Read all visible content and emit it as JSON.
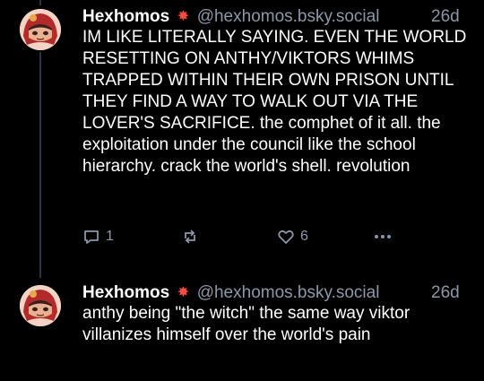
{
  "posts": [
    {
      "author": {
        "display_name": "Hexhomos",
        "badge_icon": "sparkle-emoji",
        "handle": "@hexhomos.bsky.social",
        "time": "26d"
      },
      "text": "IM LIKE LITERALLY SAYING. EVEN THE WORLD RESETTING ON ANTHY/VIKTORS WHIMS TRAPPED WITHIN THEIR OWN PRISON UNTIL THEY FIND A WAY TO WALK OUT VIA THE LOVER'S SACRIFICE. the comphet of it all. the exploitation under the council like the school hierarchy. crack the world's shell. revolution",
      "actions": {
        "reply_count": "1",
        "repost_count": "",
        "like_count": "6"
      }
    },
    {
      "author": {
        "display_name": "Hexhomos",
        "badge_icon": "sparkle-emoji",
        "handle": "@hexhomos.bsky.social",
        "time": "26d"
      },
      "text": "anthy being \"the witch\" the same way viktor villanizes himself over the world's pain"
    }
  ],
  "colors": {
    "background": "#000000",
    "text": "#ffffff",
    "muted": "#8b98a9",
    "accent": "#ff4a3d"
  }
}
